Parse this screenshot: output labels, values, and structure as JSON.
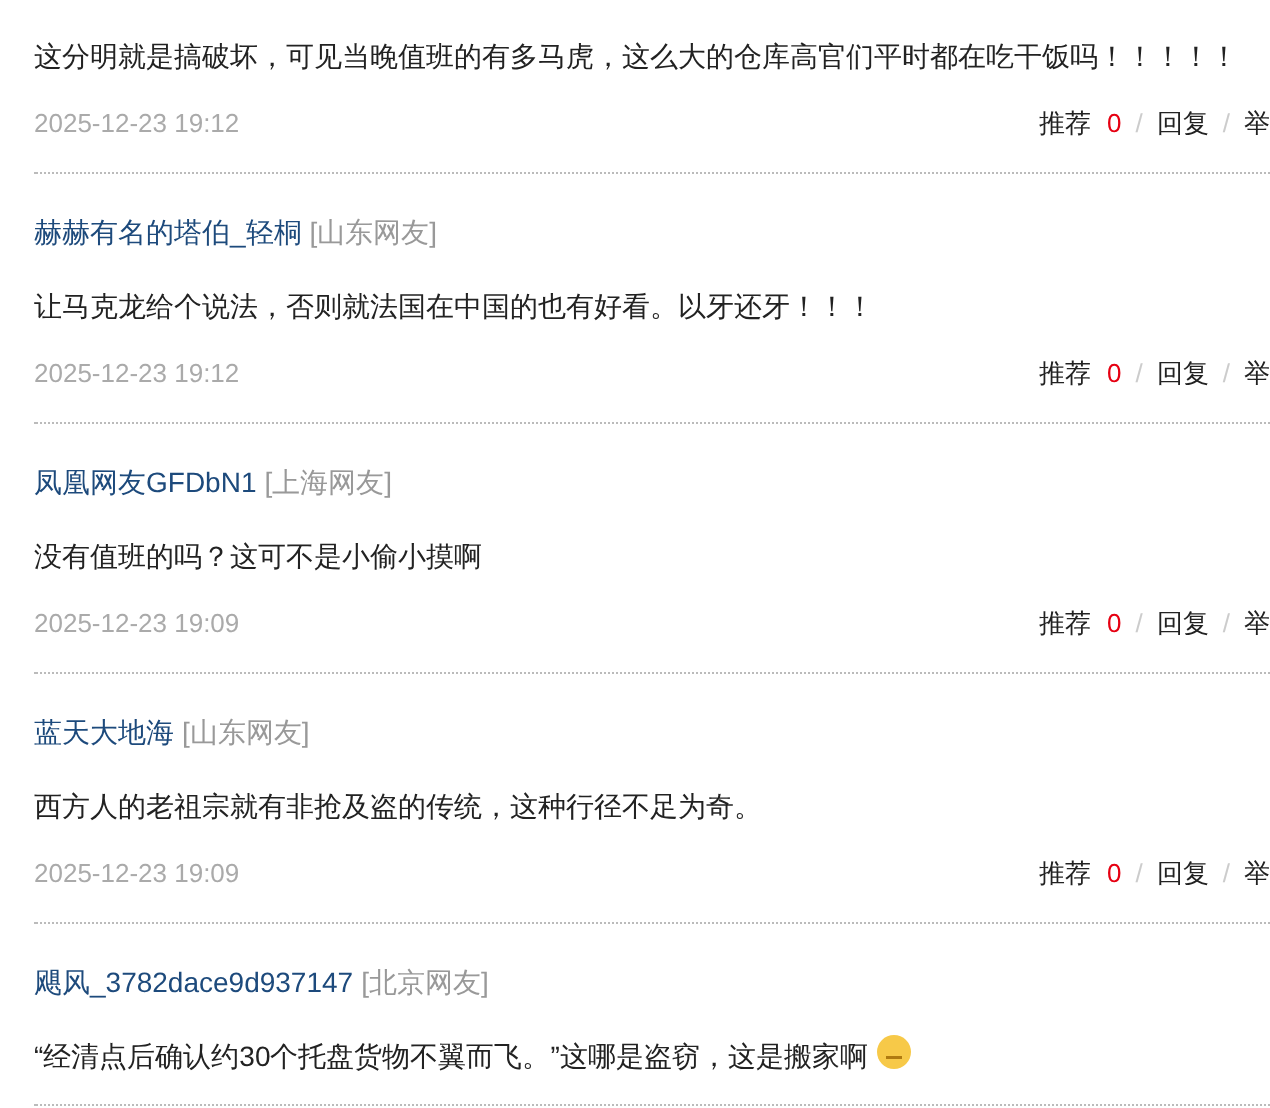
{
  "comments": [
    {
      "text": "这分明就是搞破坏，可见当晚值班的有多马虎，这么大的仓库高官们平时都在吃干饭吗！！！！！",
      "date": "2025-12-23 19:12",
      "actions": {
        "recommend": "推荐",
        "count": "0",
        "sep1": "/",
        "reply": "回复",
        "sep2": "/",
        "report": "举"
      }
    },
    {
      "user": "赫赫有名的塔伯_轻桐",
      "location": "[山东网友]",
      "text": "让马克龙给个说法，否则就法国在中国的也有好看。以牙还牙！！！",
      "date": "2025-12-23 19:12",
      "actions": {
        "recommend": "推荐",
        "count": "0",
        "sep1": "/",
        "reply": "回复",
        "sep2": "/",
        "report": "举"
      }
    },
    {
      "user": "凤凰网友GFDbN1",
      "location": "[上海网友]",
      "text": "没有值班的吗？这可不是小偷小摸啊",
      "date": "2025-12-23 19:09",
      "actions": {
        "recommend": "推荐",
        "count": "0",
        "sep1": "/",
        "reply": "回复",
        "sep2": "/",
        "report": "举"
      }
    },
    {
      "user": "蓝天大地海",
      "location": "[山东网友]",
      "text": "西方人的老祖宗就有非抢及盗的传统，这种行径不足为奇。",
      "date": "2025-12-23 19:09",
      "actions": {
        "recommend": "推荐",
        "count": "0",
        "sep1": "/",
        "reply": "回复",
        "sep2": "/",
        "report": "举"
      }
    },
    {
      "user": "飓风_3782dace9d937147",
      "location": "[北京网友]",
      "text": "“经清点后确认约30个托盘货物不翼而飞。”这哪是盗窃，这是搬家啊",
      "emoji": true
    }
  ]
}
